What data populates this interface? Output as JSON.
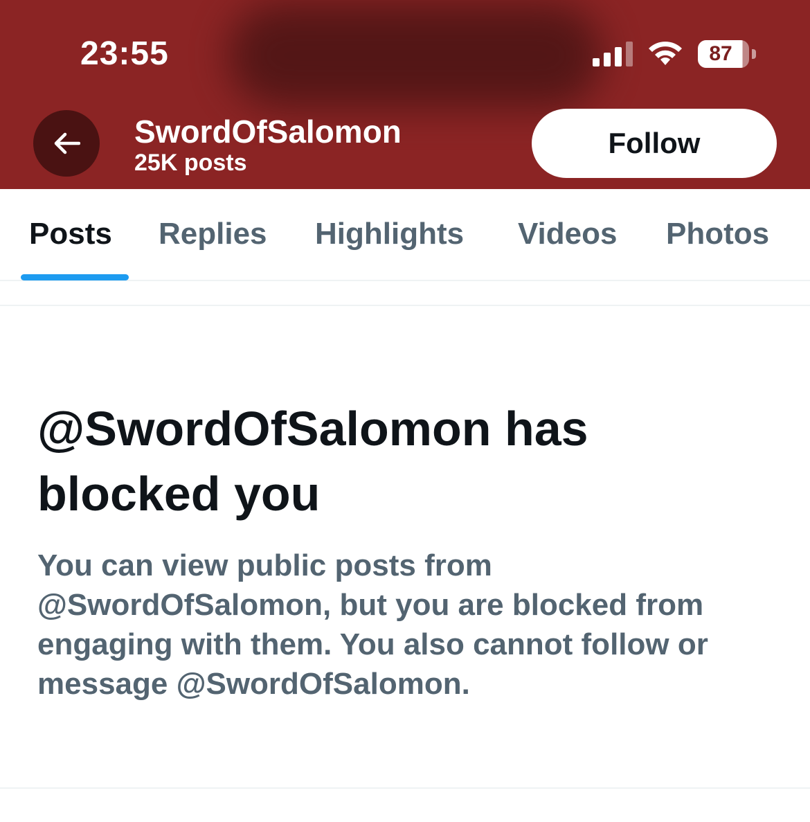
{
  "status_bar": {
    "time": "23:55",
    "battery": "87",
    "signal_icon": "cellular-signal-icon",
    "wifi_icon": "wifi-icon"
  },
  "header": {
    "back_icon": "arrow-left-icon",
    "name": "SwordOfSalomon",
    "post_count": "25K posts",
    "follow_label": "Follow",
    "background_color": "#8b2424"
  },
  "tabs": [
    {
      "label": "Posts",
      "active": true
    },
    {
      "label": "Replies",
      "active": false
    },
    {
      "label": "Highlights",
      "active": false
    },
    {
      "label": "Videos",
      "active": false
    },
    {
      "label": "Photos",
      "active": false
    }
  ],
  "tab_indicator_color": "#1d9bf0",
  "blocked": {
    "title": "@SwordOfSalomon has blocked you",
    "body": "You can view public posts from @SwordOfSalomon, but you are blocked from engaging with them. You also cannot follow or message @SwordOfSalomon."
  }
}
